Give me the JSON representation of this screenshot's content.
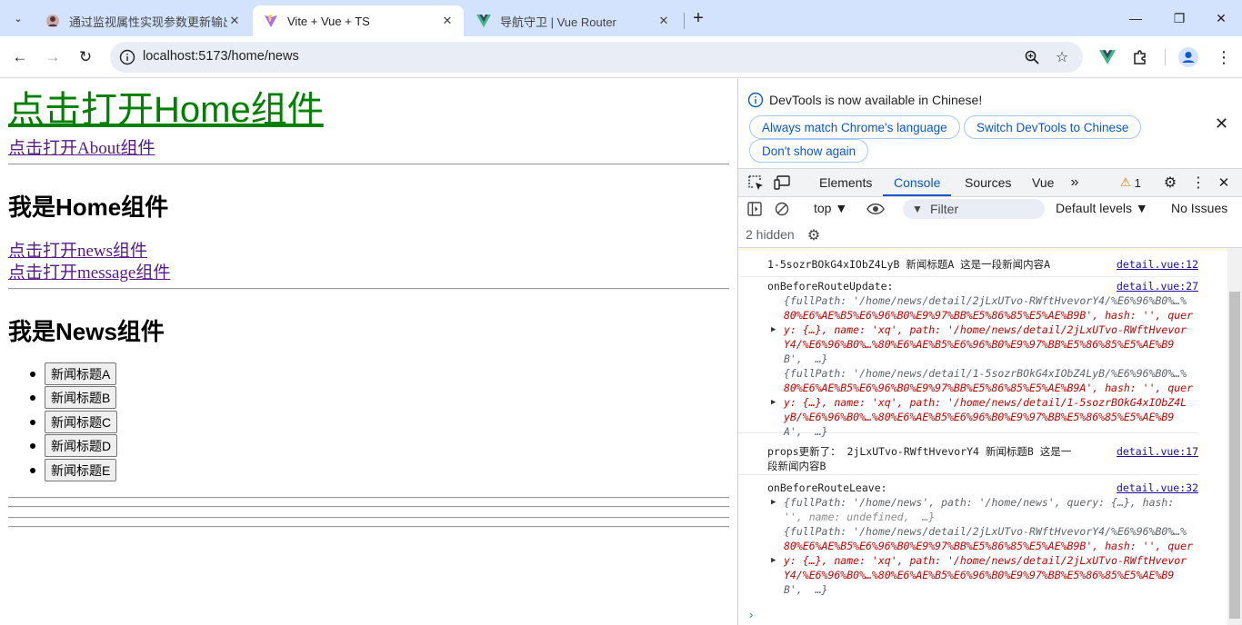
{
  "tabs": [
    {
      "title": "通过监视属性实现参数更新输出",
      "active": false
    },
    {
      "title": "Vite + Vue + TS",
      "active": true
    },
    {
      "title": "导航守卫 | Vue Router",
      "active": false
    }
  ],
  "toolbar": {
    "url": "localhost:5173/home/news"
  },
  "page": {
    "home_link": "点击打开Home组件",
    "about_link": "点击打开About组件",
    "home_heading": "我是Home组件",
    "news_link": "点击打开news组件",
    "message_link": "点击打开message组件",
    "news_heading": "我是News组件",
    "news_buttons": [
      "新闻标题A",
      "新闻标题B",
      "新闻标题C",
      "新闻标题D",
      "新闻标题E"
    ]
  },
  "devtools": {
    "infobar": {
      "message": "DevTools is now available in Chinese!",
      "btn_match": "Always match Chrome's language",
      "btn_switch": "Switch DevTools to Chinese",
      "btn_dont_show": "Don't show again"
    },
    "tabs": [
      "Elements",
      "Console",
      "Sources",
      "Vue"
    ],
    "active_tab": "Console",
    "warning_count": "1",
    "context": "top ▼",
    "filter_placeholder": "Filter",
    "levels": "Default levels ▼",
    "issues": "No Issues",
    "hidden": "2 hidden"
  },
  "console": {
    "m1": {
      "text": "1-5sozrBOkG4xIObZ4LyB 新闻标题A 这是一段新闻内容A",
      "src": "detail.vue:12"
    },
    "m2": {
      "label": "onBeforeRouteUpdate:",
      "src": "detail.vue:27",
      "lines": [
        "{fullPath: '/home/news/detail/2jLxUTvo-RWftHvevorY4/%E6%96%B0%…%",
        "80%E6%AE%B5%E6%96%B0%E9%97%BB%E5%86%85%E5%AE%B9B', hash: '', quer",
        "y: {…}, name: 'xq', path: '/home/news/detail/2jLxUTvo-RWftHvevor",
        "Y4/%E6%96%B0%…%80%E6%AE%B5%E6%96%B0%E9%97%BB%E5%86%85%E5%AE%B9",
        "B',  …}",
        "{fullPath: '/home/news/detail/1-5sozrBOkG4xIObZ4LyB/%E6%96%B0%…%",
        "80%E6%AE%B5%E6%96%B0%E9%97%BB%E5%86%85%E5%AE%B9A', hash: '', quer",
        "y: {…}, name: 'xq', path: '/home/news/detail/1-5sozrBOkG4xIObZ4L",
        "yB/%E6%96%B0%…%80%E6%AE%B5%E6%96%B0%E9%97%BB%E5%86%85%E5%AE%B9",
        "A',  …}"
      ]
    },
    "m3": {
      "line1": "props更新了： 2jLxUTvo-RWftHvevorY4 新闻标题B 这是一",
      "line2": "段新闻内容B",
      "src": "detail.vue:17"
    },
    "m4": {
      "label": "onBeforeRouteLeave:",
      "src": "detail.vue:32",
      "lines": [
        "{fullPath: '/home/news', path: '/home/news', query: {…}, hash:",
        "'', name: undefined,  …}",
        "{fullPath: '/home/news/detail/2jLxUTvo-RWftHvevorY4/%E6%96%B0%…%",
        "80%E6%AE%B5%E6%96%B0%E9%97%BB%E5%86%85%E5%AE%B9B', hash: '', quer",
        "y: {…}, name: 'xq', path: '/home/news/detail/2jLxUTvo-RWftHvevor",
        "Y4/%E6%96%B0%…%80%E6%AE%B5%E6%96%B0%E9%97%BB%E5%86%85%E5%AE%B9",
        "B',  …}"
      ]
    }
  },
  "colors": {
    "accent": "#0b57d0",
    "tabstrip": "#d3e3fd",
    "link_visited": "#551a8b",
    "home_link": "#008000"
  }
}
